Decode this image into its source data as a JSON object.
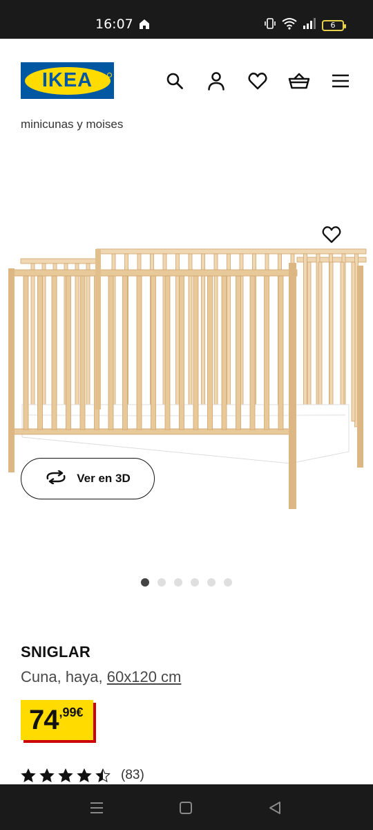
{
  "status_bar": {
    "time": "16:07",
    "battery": "6"
  },
  "header": {
    "logo_text": "IKEA"
  },
  "breadcrumb": {
    "text": "minicunas y moises"
  },
  "gallery": {
    "view3d_label": "Ver en 3D",
    "image_count": 6,
    "active_index": 0
  },
  "product": {
    "name": "SNIGLAR",
    "description": "Cuna, haya,",
    "size": "60x120 cm",
    "price_int": "74",
    "price_dec": ",99€",
    "rating_value": 4.5,
    "rating_count": "(83)"
  },
  "colors": {
    "ikea_blue": "#0058a3",
    "ikea_yellow": "#ffdb00",
    "price_shadow": "#cc0008",
    "wood": "#e8c99a"
  },
  "icons": [
    "home-icon",
    "vibrate-icon",
    "wifi-icon",
    "signal-icon",
    "battery-icon",
    "search-icon",
    "user-icon",
    "heart-icon",
    "basket-icon",
    "menu-icon",
    "rotate-3d-icon",
    "star-icon",
    "recent-apps-icon",
    "home-square-icon",
    "back-icon"
  ]
}
